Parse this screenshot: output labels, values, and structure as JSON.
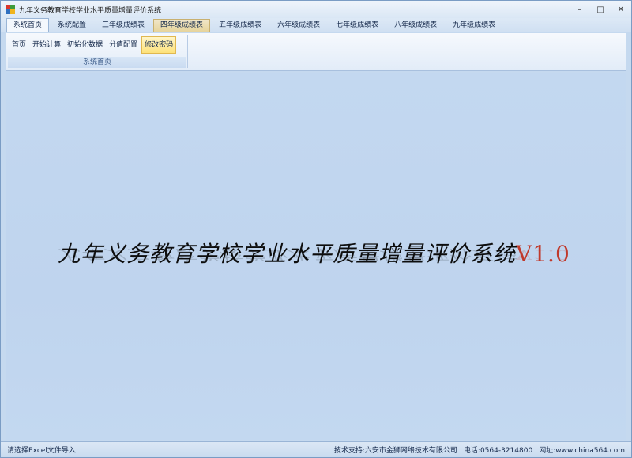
{
  "app": {
    "title": "九年义务教育学校学业水平质量增量评价系统"
  },
  "window_controls": {
    "minimize": "–",
    "maximize": "□",
    "close": "✕"
  },
  "tabs": [
    {
      "label": "系统首页",
      "state": "active"
    },
    {
      "label": "系统配置"
    },
    {
      "label": "三年级成绩表"
    },
    {
      "label": "四年级成绩表",
      "state": "hover"
    },
    {
      "label": "五年级成绩表"
    },
    {
      "label": "六年级成绩表"
    },
    {
      "label": "七年级成绩表"
    },
    {
      "label": "八年级成绩表"
    },
    {
      "label": "九年级成绩表"
    }
  ],
  "ribbon": {
    "group_label": "系统首页",
    "buttons": [
      {
        "label": "首页"
      },
      {
        "label": "开始计算"
      },
      {
        "label": "初始化数据"
      },
      {
        "label": "分值配置"
      },
      {
        "label": "修改密码",
        "state": "highlighted"
      }
    ]
  },
  "main": {
    "headline": "九年义务教育学校学业水平质量增量评价系统",
    "version": "V1.0"
  },
  "status": {
    "left": "请选择Excel文件导入",
    "support": "技术支持:六安市金狮网络技术有限公司",
    "phone": "电话:0564-3214800",
    "website": "网址:www.china564.com"
  },
  "colors": {
    "icon_red": "#d9362b",
    "icon_green": "#3f9b3a",
    "icon_blue": "#2f6fc0",
    "icon_yellow": "#f0b41c",
    "version_red": "#c0392b"
  }
}
